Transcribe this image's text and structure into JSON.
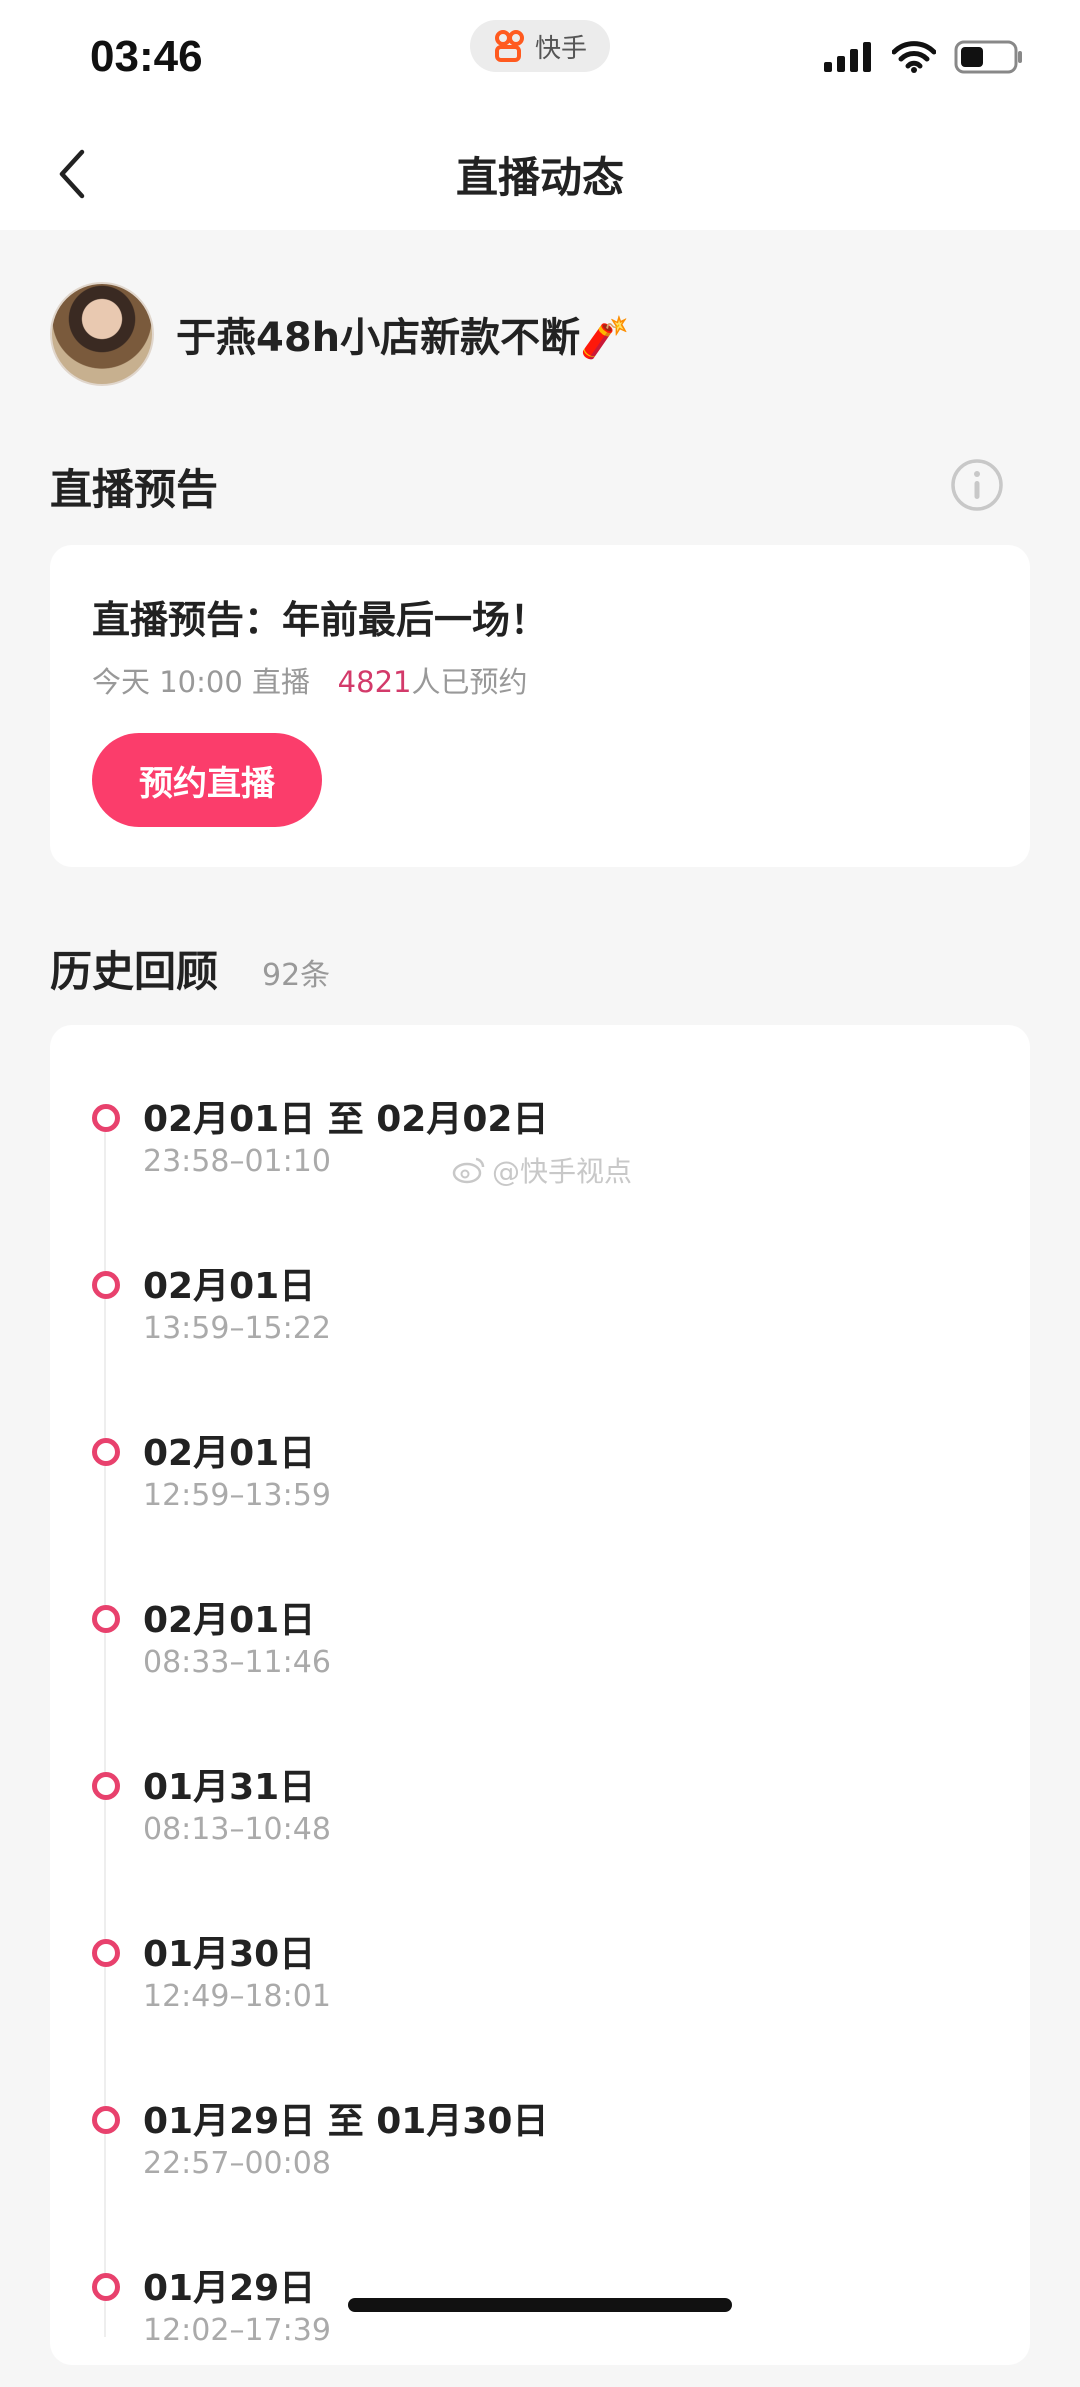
{
  "status_bar": {
    "time": "03:46",
    "app_pill": "快手",
    "icons": [
      "signal-icon",
      "wifi-icon",
      "battery-icon"
    ]
  },
  "nav": {
    "back_icon": "chevron-left-icon",
    "title": "直播动态"
  },
  "profile": {
    "name": "于燕48h小店新款不断🧨"
  },
  "preview_section": {
    "title": "直播预告",
    "info_icon": "info-icon",
    "card": {
      "title": "直播预告：年前最后一场！",
      "schedule": "今天 10:00 直播",
      "reserved_count": "4821",
      "reserved_suffix": "人已预约",
      "button_label": "预约直播"
    }
  },
  "history_section": {
    "title": "历史回顾",
    "count": "92条",
    "watermark": "@快手视点",
    "items": [
      {
        "date": "02月01日 至 02月02日",
        "time": "23:58–01:10"
      },
      {
        "date": "02月01日",
        "time": "13:59–15:22"
      },
      {
        "date": "02月01日",
        "time": "12:59–13:59"
      },
      {
        "date": "02月01日",
        "time": "08:33–11:46"
      },
      {
        "date": "01月31日",
        "time": "08:13–10:48"
      },
      {
        "date": "01月30日",
        "time": "12:49–18:01"
      },
      {
        "date": "01月29日 至 01月30日",
        "time": "22:57–00:08"
      },
      {
        "date": "01月29日",
        "time": "12:02–17:39"
      }
    ]
  },
  "colors": {
    "accent": "#fb3d6b",
    "timeline_dot": "#e8416d",
    "count_text": "#d33a6a"
  }
}
